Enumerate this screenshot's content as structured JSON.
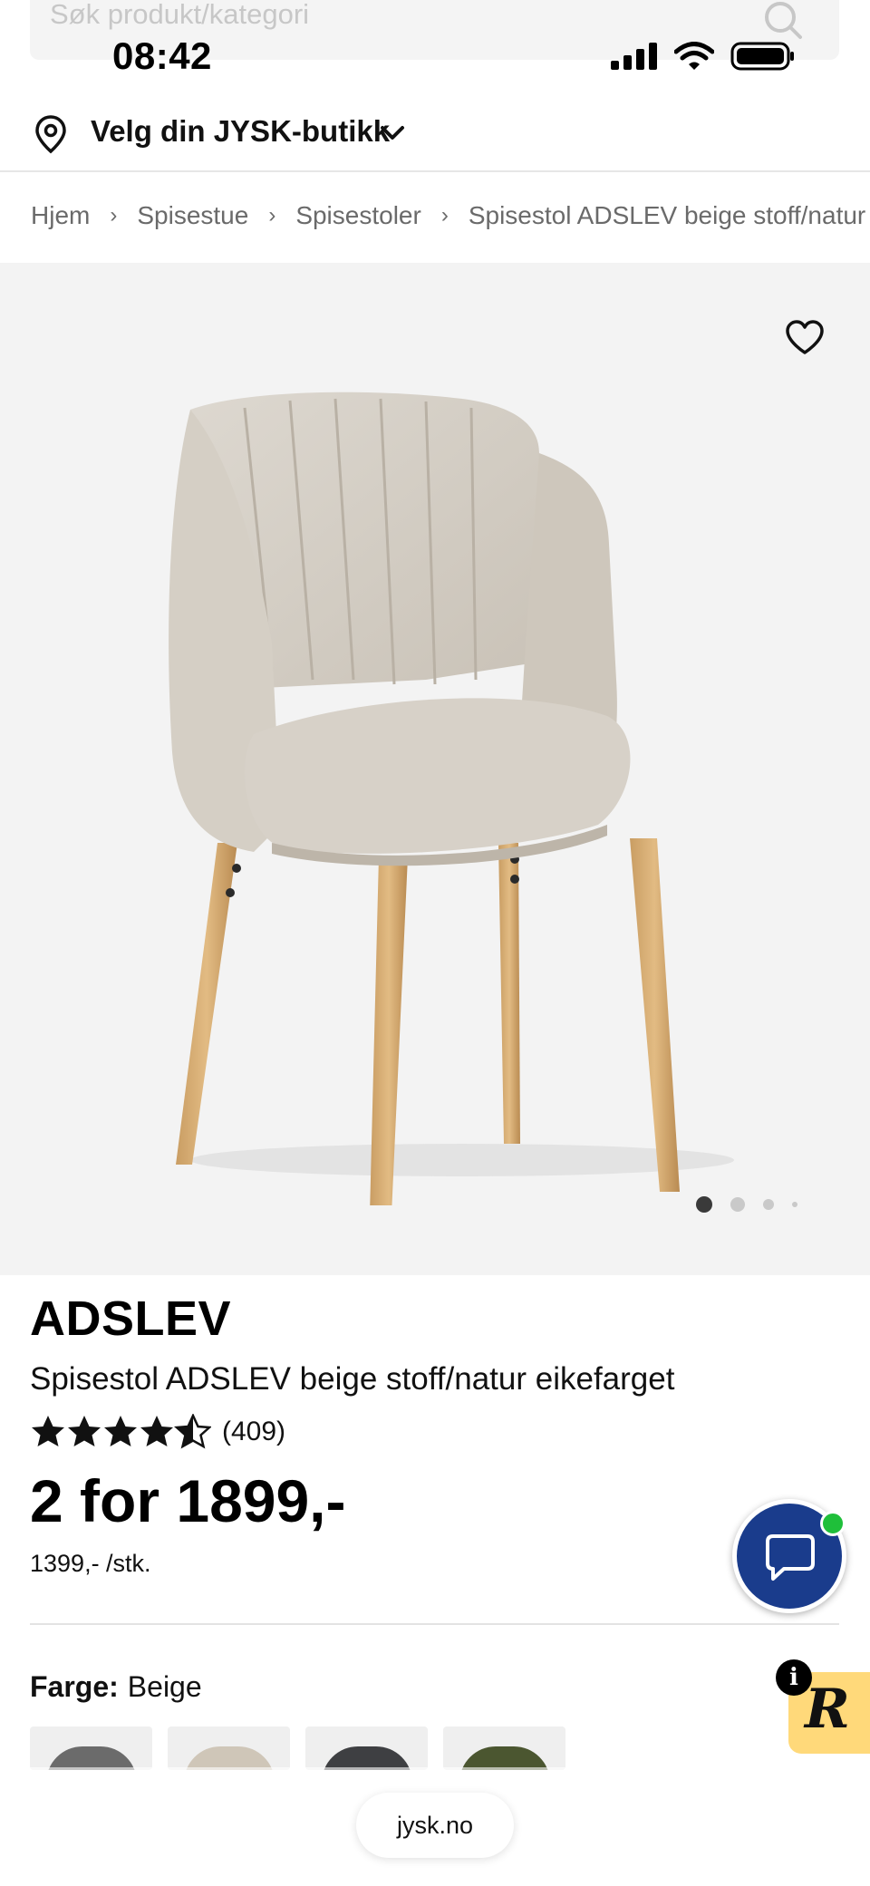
{
  "search": {
    "placeholder": "Søk produkt/kategori"
  },
  "status_bar": {
    "time": "08:42"
  },
  "store_selector": {
    "label": "Velg din JYSK-butikk"
  },
  "breadcrumb": [
    "Hjem",
    "Spisestue",
    "Spisestoler",
    "Spisestol ADSLEV beige stoff/natur"
  ],
  "gallery": {
    "image_count": 4,
    "active_index": 0
  },
  "product": {
    "brand": "ADSLEV",
    "name": "Spisestol ADSLEV beige stoff/natur eikefarget",
    "rating": 4.5,
    "review_count": "(409)",
    "price": "2 for 1899,-",
    "unit_price": "1399,- /stk.",
    "color_label": "Farge:",
    "color_value": "Beige",
    "swatches": [
      {
        "name": "grey",
        "color": "#6b6b6b"
      },
      {
        "name": "beige",
        "color": "#cfc6b8"
      },
      {
        "name": "dark-grey",
        "color": "#3e3f42"
      },
      {
        "name": "olive",
        "color": "#4b5630"
      }
    ]
  },
  "colors": {
    "chat_bg": "#1a3c8c",
    "online": "#1fbf3a",
    "widget_bg": "#ffd97a",
    "hero_bg": "#f3f3f3"
  },
  "url": "jysk.no"
}
